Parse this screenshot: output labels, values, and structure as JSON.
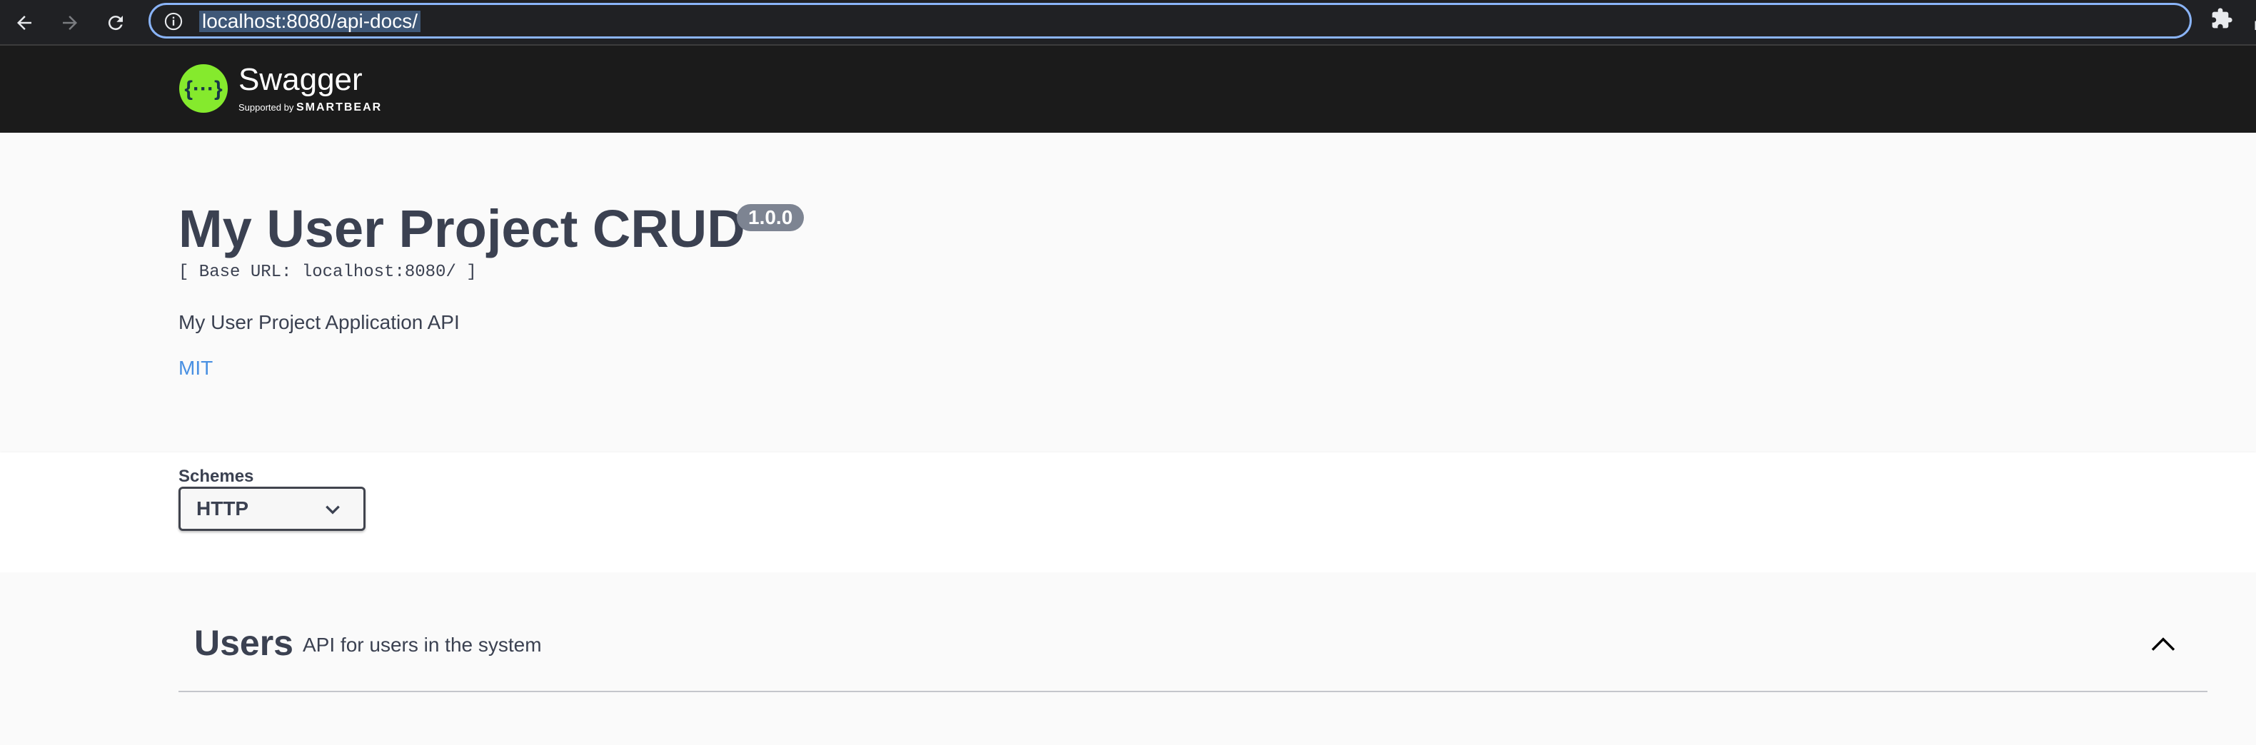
{
  "browser": {
    "url": "localhost:8080/api-docs/"
  },
  "topbar": {
    "logo_text": "Swagger",
    "supported_prefix": "Supported by",
    "supported_brand": "SMARTBEAR",
    "logo_color": "#85ea2d"
  },
  "info": {
    "title": "My User Project CRUD",
    "version": "1.0.0",
    "base_url": "[ Base URL: localhost:8080/ ]",
    "description": "My User Project Application API",
    "license": "MIT"
  },
  "schemes": {
    "label": "Schemes",
    "selected": "HTTP"
  },
  "tags": [
    {
      "name": "Users",
      "description": "API for users in the system",
      "expanded": true
    }
  ],
  "colors": {
    "topbar_bg": "#1b1b1b",
    "link": "#4990e2",
    "text": "#3b4151",
    "badge": "#7d8492"
  }
}
